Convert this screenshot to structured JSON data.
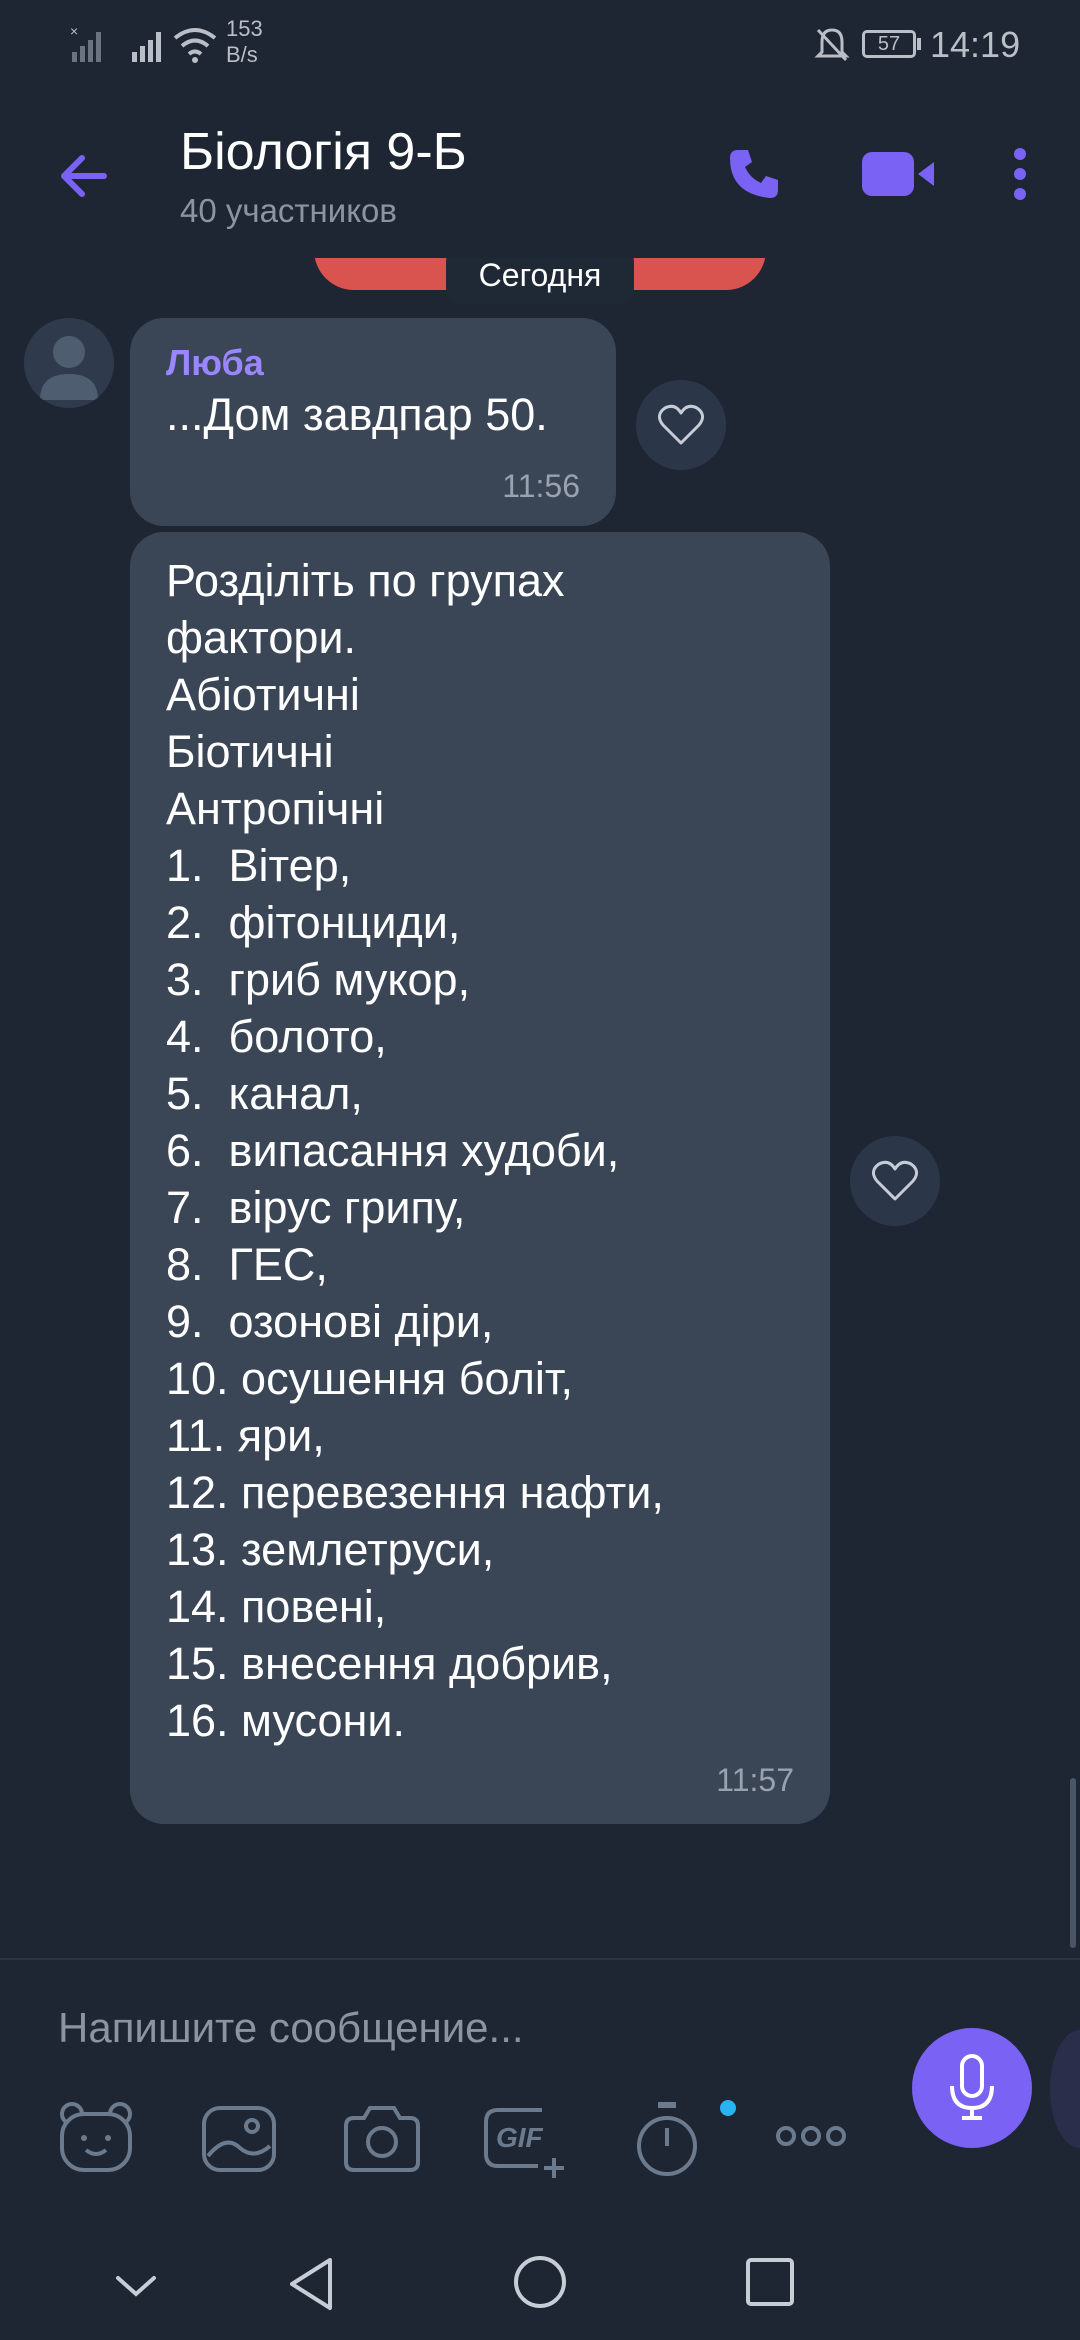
{
  "status_bar": {
    "net_speed_value": "153",
    "net_speed_unit": "B/s",
    "battery": "57",
    "time": "14:19"
  },
  "header": {
    "title": "Біологія 9-Б",
    "subtitle": "40 участников"
  },
  "chat": {
    "date_label": "Сегодня",
    "messages": [
      {
        "sender": "Люба",
        "text": "...Дом завдпар 50.",
        "time": "11:56"
      },
      {
        "text": "Розділіть по групах\nфактори.\nАбіотичні\nБіотичні\nАнтропічні\n1.  Вітер,\n2.  фітонциди,\n3.  гриб мукор,\n4.  болото,\n5.  канал,\n6.  випасання худоби,\n7.  вірус грипу,\n8.  ГЕС,\n9.  озонові діри,\n10. осушення боліт,\n11. яри,\n12. перевезення нафти,\n13. землетруси,\n14. повені,\n15. внесення добрив,\n16. мусони.",
        "time": "11:57"
      }
    ]
  },
  "composer": {
    "placeholder": "Напишите сообщение...",
    "gif_label": "GIF"
  },
  "colors": {
    "accent": "#7a62f4",
    "background": "#1e2633",
    "bubble": "#3a4656",
    "sender_name": "#9a86ff"
  },
  "icons": [
    "signal-off-icon",
    "signal-icon",
    "wifi-icon",
    "mute-icon",
    "battery-icon",
    "back-arrow-icon",
    "phone-icon",
    "video-icon",
    "more-vert-icon",
    "avatar-icon",
    "heart-icon",
    "sticker-icon",
    "gallery-icon",
    "camera-icon",
    "gif-icon",
    "timer-icon",
    "more-horiz-icon",
    "mic-icon",
    "nav-down-icon",
    "nav-back-icon",
    "nav-home-icon",
    "nav-recents-icon"
  ]
}
